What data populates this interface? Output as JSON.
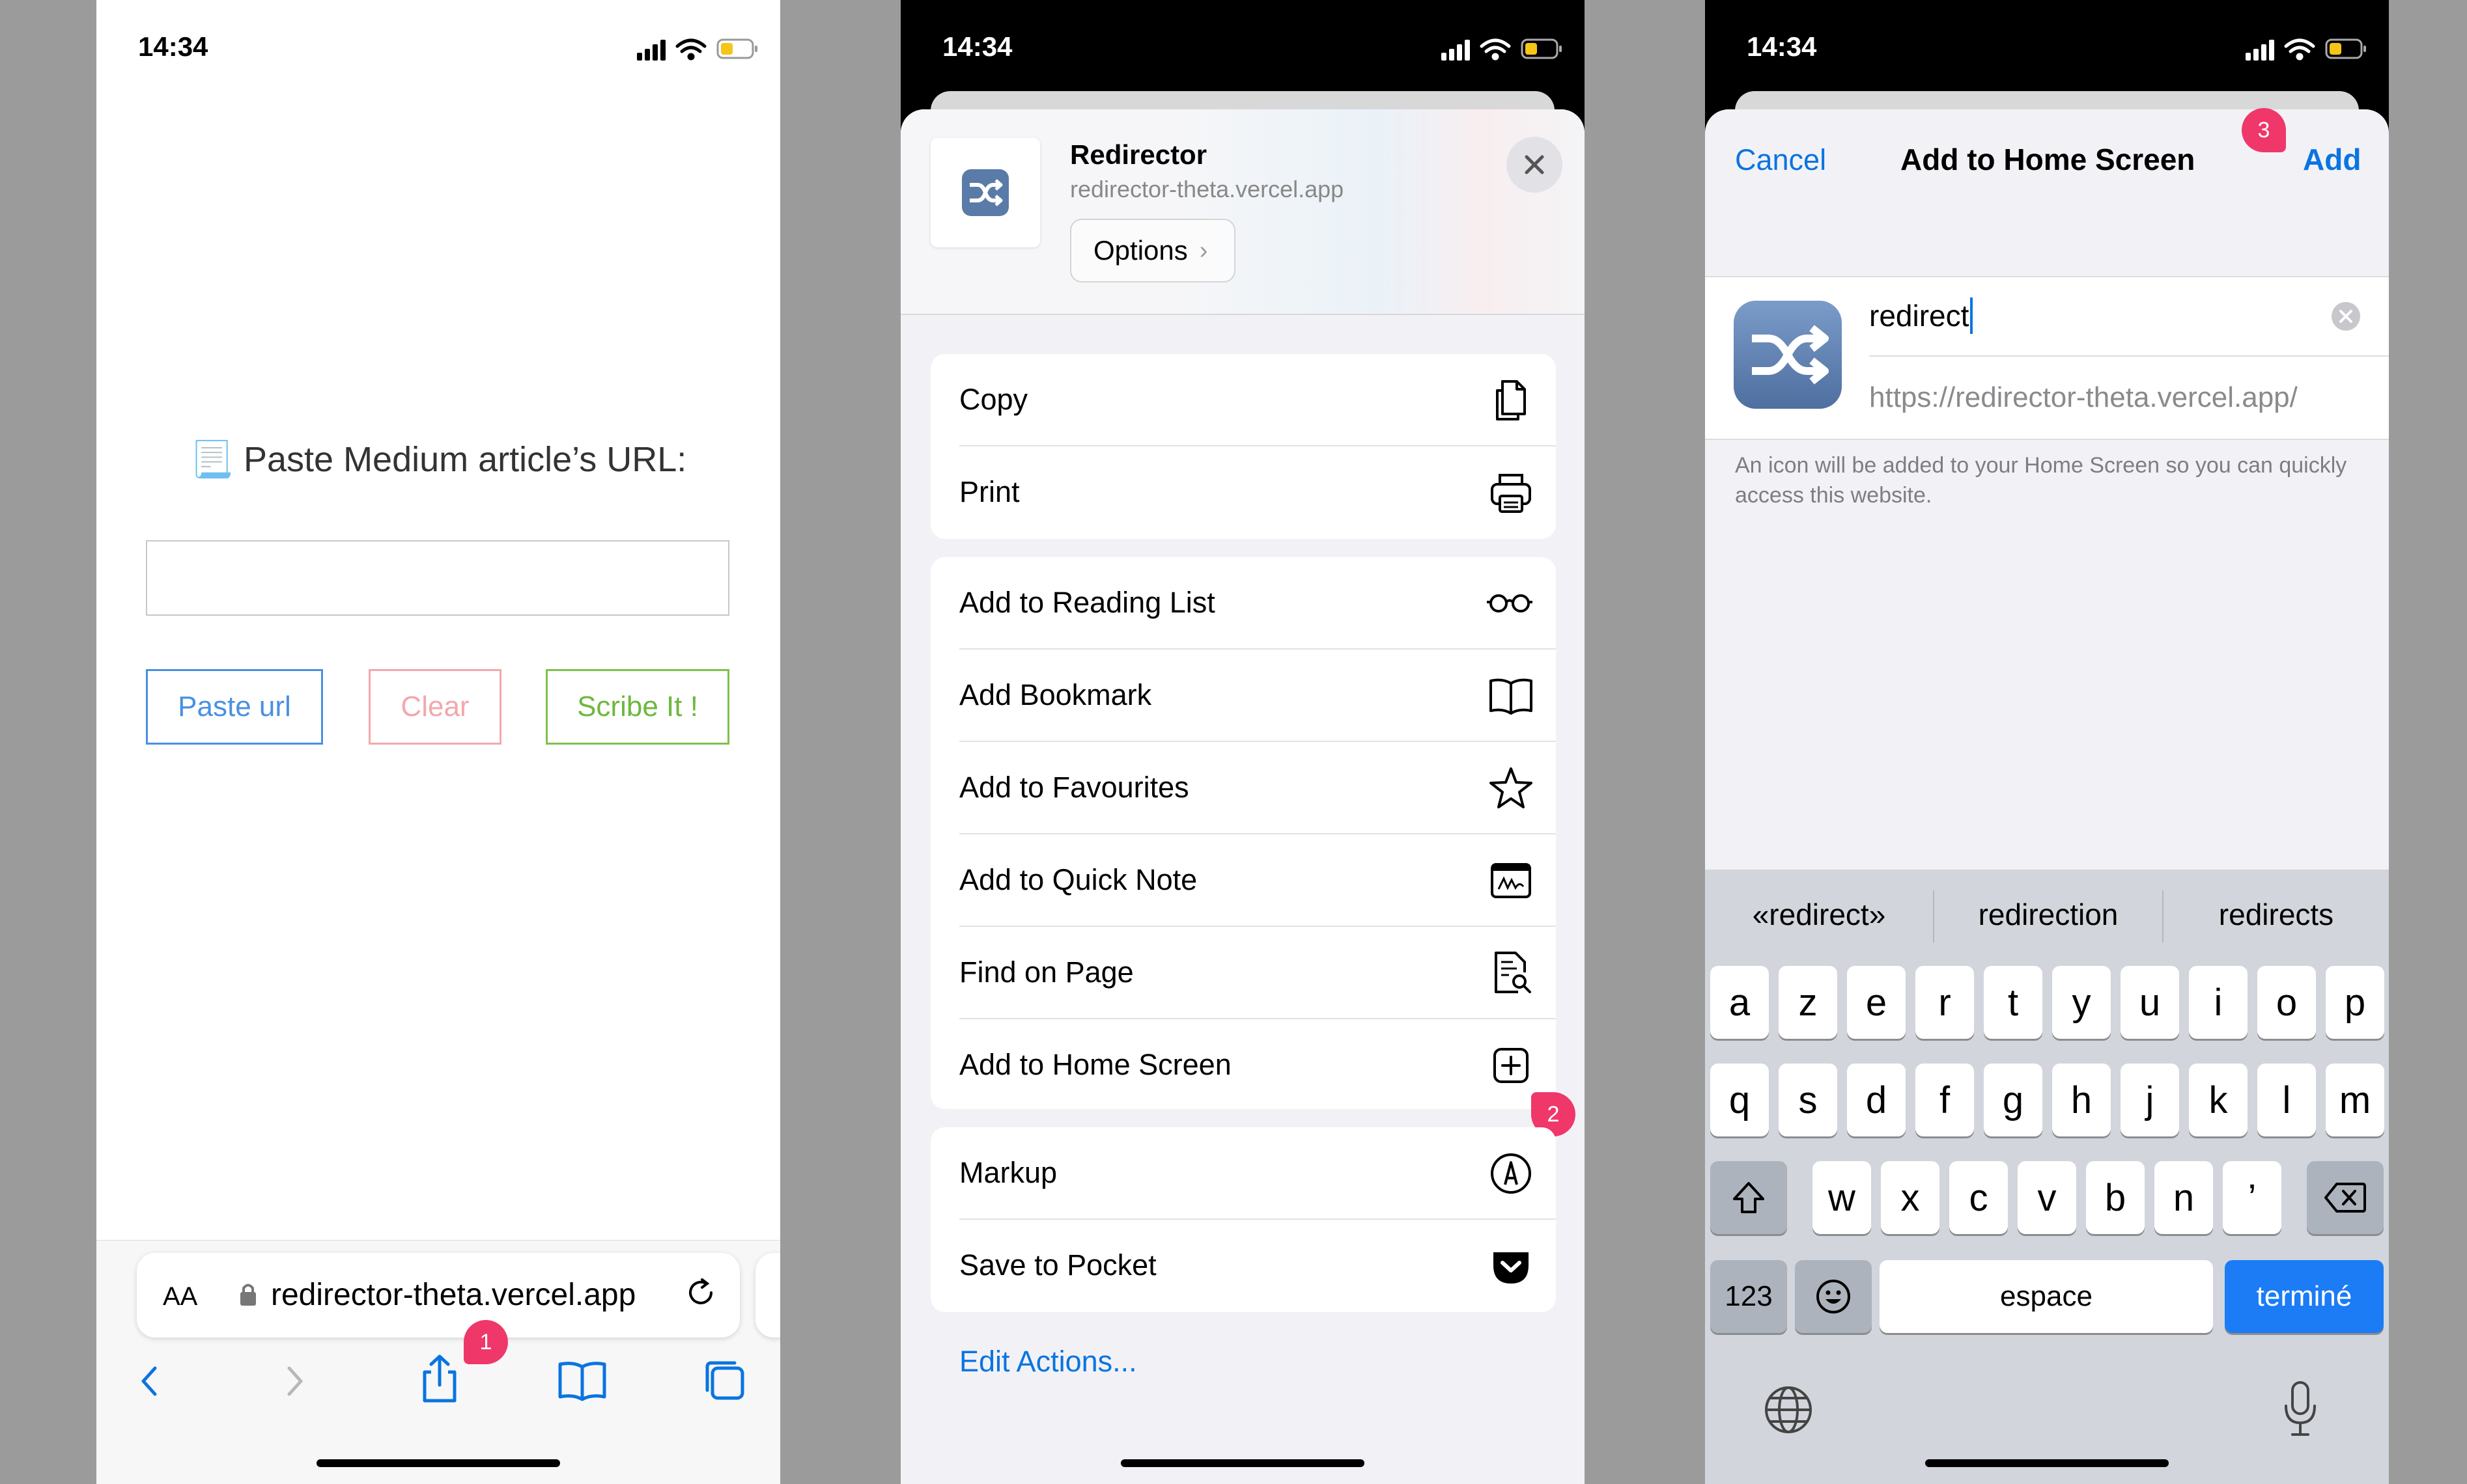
{
  "status": {
    "time": "14:34"
  },
  "screen1": {
    "prompt": "📃 Paste Medium article’s URL:",
    "input_value": "",
    "buttons": {
      "paste": "Paste url",
      "clear": "Clear",
      "scribe": "Scribe It !"
    },
    "address_bar": {
      "aa": "AA",
      "url": "redirector-theta.vercel.app"
    },
    "badge": "1"
  },
  "screen2": {
    "app_name": "Redirector",
    "app_url": "redirector-theta.vercel.app",
    "options": "Options",
    "group1": [
      {
        "label": "Copy",
        "icon": "copy-icon"
      },
      {
        "label": "Print",
        "icon": "print-icon"
      }
    ],
    "group2": [
      {
        "label": "Add to Reading List",
        "icon": "glasses-icon"
      },
      {
        "label": "Add Bookmark",
        "icon": "book-icon"
      },
      {
        "label": "Add to Favourites",
        "icon": "star-icon"
      },
      {
        "label": "Add to Quick Note",
        "icon": "quick-note-icon"
      },
      {
        "label": "Find on Page",
        "icon": "find-on-page-icon"
      },
      {
        "label": "Add to Home Screen",
        "icon": "add-square-icon"
      }
    ],
    "group3": [
      {
        "label": "Markup",
        "icon": "markup-icon"
      },
      {
        "label": "Save to Pocket",
        "icon": "pocket-icon"
      }
    ],
    "edit_actions": "Edit Actions...",
    "badge": "2"
  },
  "screen3": {
    "cancel": "Cancel",
    "title": "Add to Home Screen",
    "add": "Add",
    "badge": "3",
    "name_value": "redirect",
    "url": "https://redirector-theta.vercel.app/",
    "info": "An icon will be added to your Home Screen so you can quickly access this website.",
    "suggestions": [
      "«redirect»",
      "redirection",
      "redirects"
    ],
    "keys_row1": [
      "a",
      "z",
      "e",
      "r",
      "t",
      "y",
      "u",
      "i",
      "o",
      "p"
    ],
    "keys_row2": [
      "q",
      "s",
      "d",
      "f",
      "g",
      "h",
      "j",
      "k",
      "l",
      "m"
    ],
    "keys_row3": [
      "w",
      "x",
      "c",
      "v",
      "b",
      "n",
      "’"
    ],
    "key_123": "123",
    "space": "espace",
    "done": "terminé"
  },
  "colors": {
    "ios_blue": "#0a74e0",
    "badge": "#f0376a",
    "done_blue": "#1b7cf5"
  }
}
